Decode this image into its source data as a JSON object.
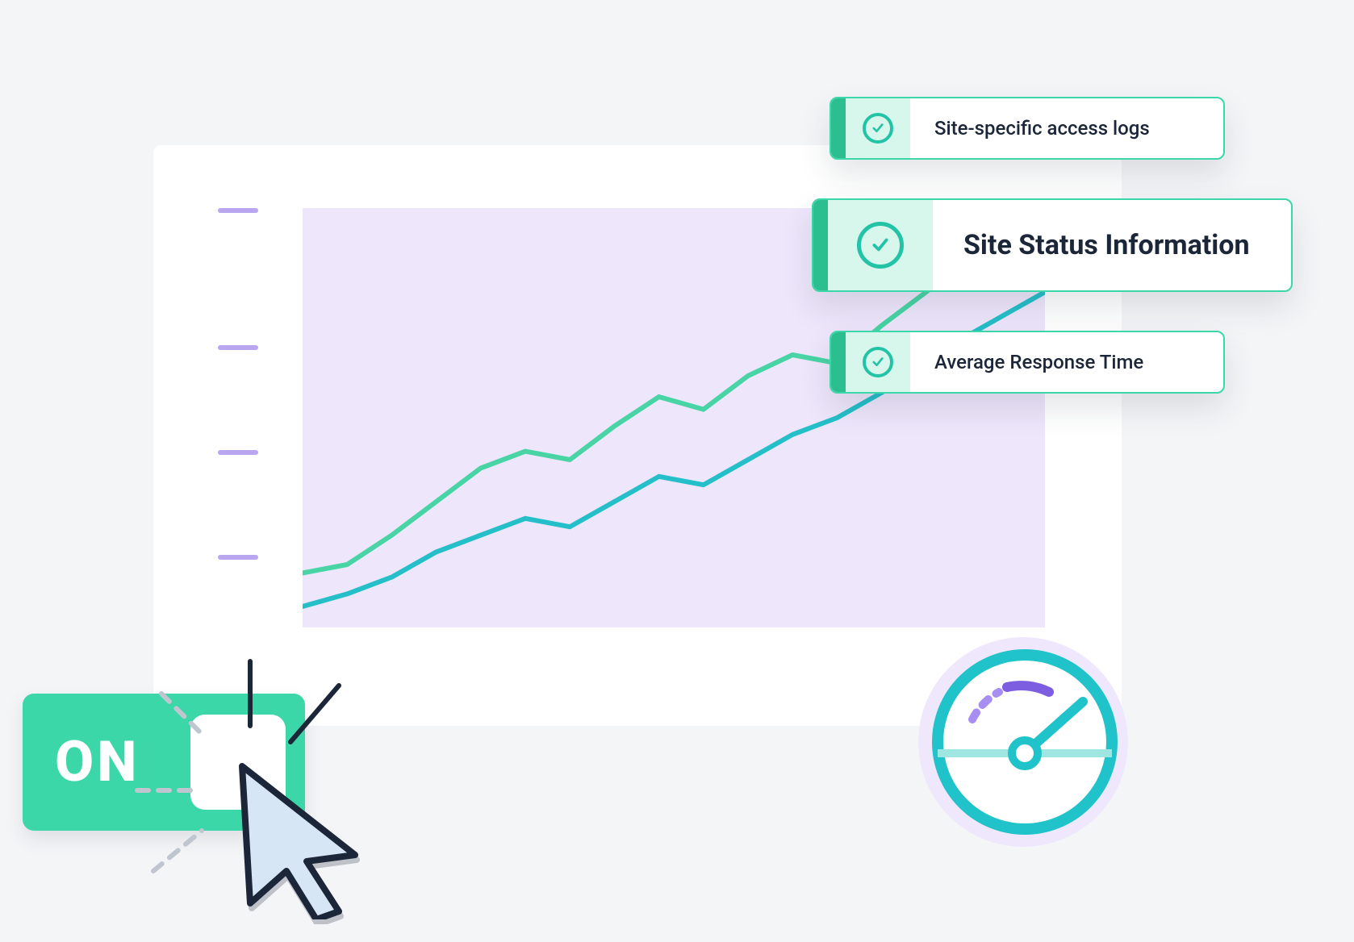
{
  "cards": {
    "card1": "Site-specific access logs",
    "card2": "Site Status Information",
    "card3": "Average Response Time"
  },
  "toggle": {
    "label": "ON"
  },
  "colors": {
    "accent": "#3cd7a9",
    "accent_dark": "#2bbf90",
    "line_green": "#48d4a5",
    "line_teal": "#25bfc9",
    "purple_light": "#eee6fb",
    "purple_tick": "#b9a6f0",
    "gauge_ring": "#1fc3c9",
    "gauge_arc": "#8a6de8",
    "text": "#1b2638"
  },
  "chart_data": {
    "type": "line",
    "x_range": [
      0,
      100
    ],
    "y_range": [
      0,
      100
    ],
    "y_ticks": [
      17,
      42,
      67,
      100
    ],
    "series": [
      {
        "name": "series-green",
        "color": "#48d4a5",
        "x": [
          0,
          6,
          12,
          18,
          24,
          30,
          36,
          42,
          48,
          54,
          60,
          66,
          72,
          78,
          84,
          90,
          96,
          100
        ],
        "values": [
          13,
          15,
          22,
          30,
          38,
          42,
          40,
          48,
          55,
          52,
          60,
          65,
          63,
          72,
          80,
          88,
          95,
          98
        ]
      },
      {
        "name": "series-teal",
        "color": "#25bfc9",
        "x": [
          0,
          6,
          12,
          18,
          24,
          30,
          36,
          42,
          48,
          54,
          60,
          66,
          72,
          78,
          84,
          90,
          96,
          100
        ],
        "values": [
          5,
          8,
          12,
          18,
          22,
          26,
          24,
          30,
          36,
          34,
          40,
          46,
          50,
          56,
          62,
          70,
          76,
          80
        ]
      }
    ]
  },
  "gauge": {
    "value_fraction": 0.35
  }
}
